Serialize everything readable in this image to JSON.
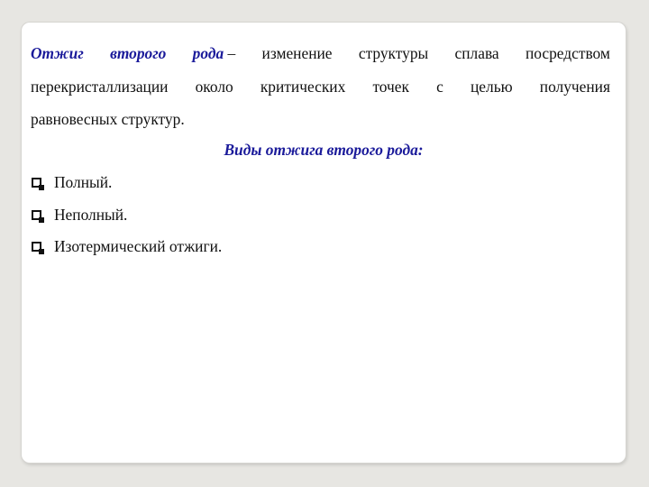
{
  "definition": {
    "term_words": [
      "Отжиг",
      "второго",
      "рода"
    ],
    "dash": "–",
    "line1_words": [
      "изменение",
      "структуры",
      "сплава",
      "посредством"
    ],
    "line2_words": [
      "перекристаллизации",
      "около",
      "критических",
      "точек",
      "с",
      "целью",
      "получения"
    ],
    "line3": "равновесных структур."
  },
  "subtitle": "Виды отжига второго рода:",
  "list": {
    "items": [
      {
        "label": "Полный."
      },
      {
        "label": "Неполный."
      },
      {
        "label": "Изотермический отжиги."
      }
    ]
  },
  "colors": {
    "accent": "#1a1a9a",
    "text": "#111111",
    "background": "#e7e6e2",
    "slide": "#ffffff"
  }
}
